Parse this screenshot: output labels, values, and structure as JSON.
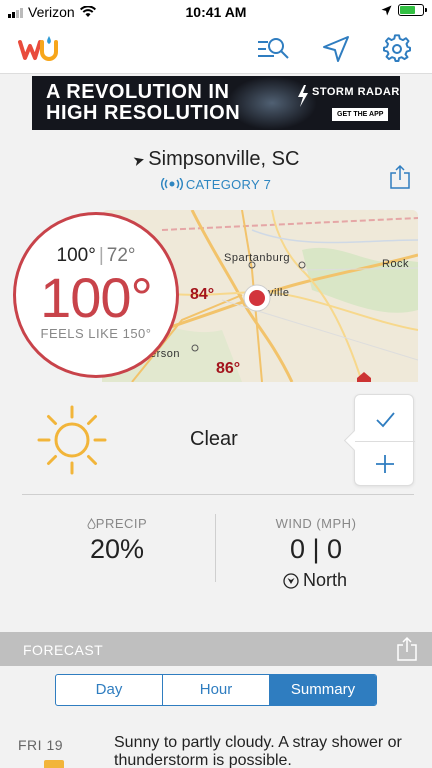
{
  "status_bar": {
    "carrier": "Verizon",
    "time": "10:41 AM",
    "battery_level": 0.7
  },
  "nav": {
    "search_icon": "search-list-icon",
    "location_icon": "location-arrow-icon",
    "settings_icon": "gear-icon"
  },
  "ad": {
    "headline_line1": "A REVOLUTION IN",
    "headline_line2": "HIGH RESOLUTION",
    "brand": "STORM RADAR",
    "cta": "GET THE APP"
  },
  "location": {
    "city": "Simpsonville, SC",
    "category": "CATEGORY 7"
  },
  "map": {
    "cities": {
      "spartanburg": "Spartanburg",
      "rock": "Rock",
      "ville": "ville",
      "erson": "erson"
    },
    "temps": {
      "t1": "84°",
      "t2": "86°"
    }
  },
  "current": {
    "high": "100°",
    "low": "72°",
    "temp": "100°",
    "feels_like": "FEELS LIKE 150°",
    "condition": "Clear"
  },
  "stats": {
    "precip_label": "PRECIP",
    "precip_value": "20%",
    "wind_label": "WIND (MPH)",
    "wind_value": "0 | 0",
    "wind_direction": "North"
  },
  "forecast": {
    "header": "FORECAST",
    "tabs": [
      "Day",
      "Hour",
      "Summary"
    ],
    "selected_tab": "Summary",
    "day_label": "FRI 19",
    "day_text": "Sunny to partly cloudy. A stray shower or thunderstorm is possible."
  },
  "colors": {
    "accent_red": "#c8434a",
    "accent_blue": "#2f7dc0",
    "category_blue": "#2e86c1"
  }
}
